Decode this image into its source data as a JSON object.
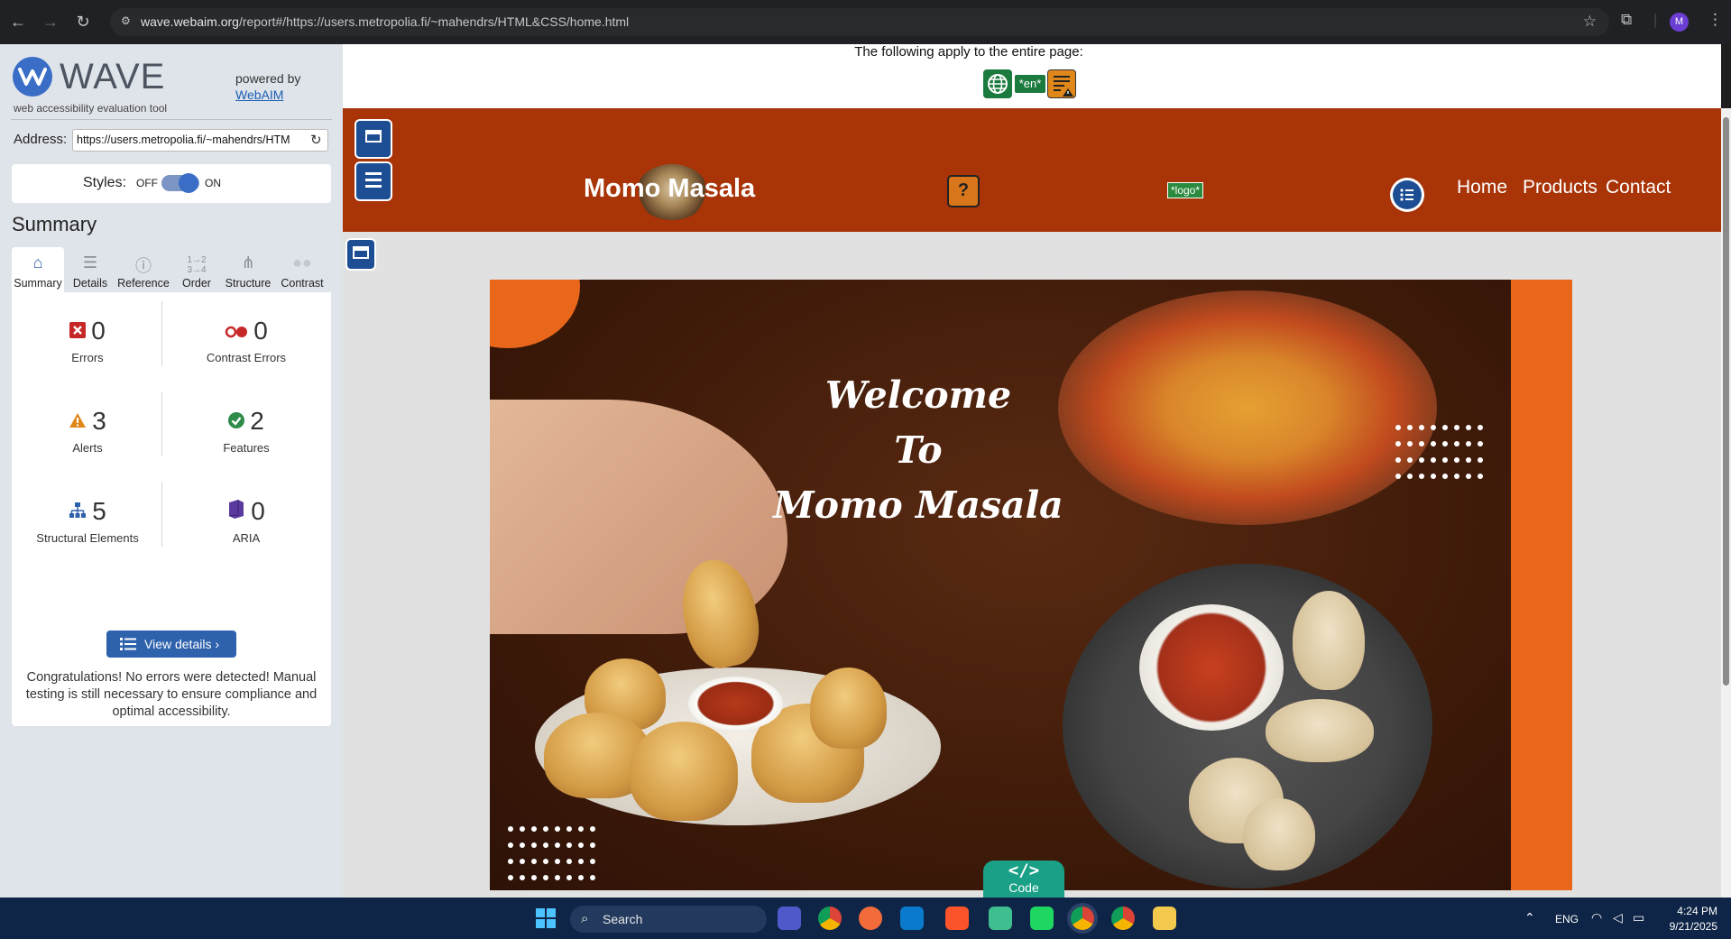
{
  "browser": {
    "url_host": "wave.webaim.org",
    "url_path": "/report#/https://users.metropolia.fi/~mahendrs/HTML&CSS/home.html",
    "profile_initial": "M"
  },
  "wave": {
    "title": "WAVE",
    "subtitle": "web accessibility evaluation tool",
    "powered_by": "powered by",
    "webaim_link": "WebAIM",
    "address_label": "Address:",
    "address_value": "https://users.metropolia.fi/~mahendrs/HTM",
    "styles_label": "Styles:",
    "styles_off": "OFF",
    "styles_on": "ON",
    "summary_heading": "Summary",
    "tabs": [
      {
        "label": "Summary",
        "icon": "home-icon"
      },
      {
        "label": "Details",
        "icon": "list-icon"
      },
      {
        "label": "Reference",
        "icon": "info-icon"
      },
      {
        "label": "Order",
        "icon": "order-icon"
      },
      {
        "label": "Structure",
        "icon": "structure-icon"
      },
      {
        "label": "Contrast",
        "icon": "contrast-icon"
      }
    ],
    "stats": {
      "errors": {
        "value": "0",
        "label": "Errors"
      },
      "contrast_errors": {
        "value": "0",
        "label": "Contrast Errors"
      },
      "alerts": {
        "value": "3",
        "label": "Alerts"
      },
      "features": {
        "value": "2",
        "label": "Features"
      },
      "structural": {
        "value": "5",
        "label": "Structural Elements"
      },
      "aria": {
        "value": "0",
        "label": "ARIA"
      }
    },
    "view_details": "View details ›",
    "congrats": "Congratulations! No errors were detected! Manual testing is still necessary to ensure compliance and optimal accessibility.",
    "colors": {
      "accent": "#2f62ad",
      "sidebar_bg": "#dfe3ea"
    }
  },
  "page": {
    "apply_text": "The following apply to the entire page:",
    "lang_badge": "*en*",
    "brand": "Momo Masala",
    "logo_badge": "*logo*",
    "nav": [
      "Home",
      "Products",
      "Contact"
    ],
    "hero_title_lines": [
      "Welcome",
      "To",
      "Momo Masala"
    ],
    "code_symbol": "</>",
    "code_label": "Code",
    "colors": {
      "header": "#a83407",
      "hero_accent": "#e8671b",
      "code_tab": "#1aa087"
    }
  },
  "taskbar": {
    "search_placeholder": "Search",
    "lang": "ENG",
    "time": "4:24 PM",
    "date": "9/21/2025"
  }
}
